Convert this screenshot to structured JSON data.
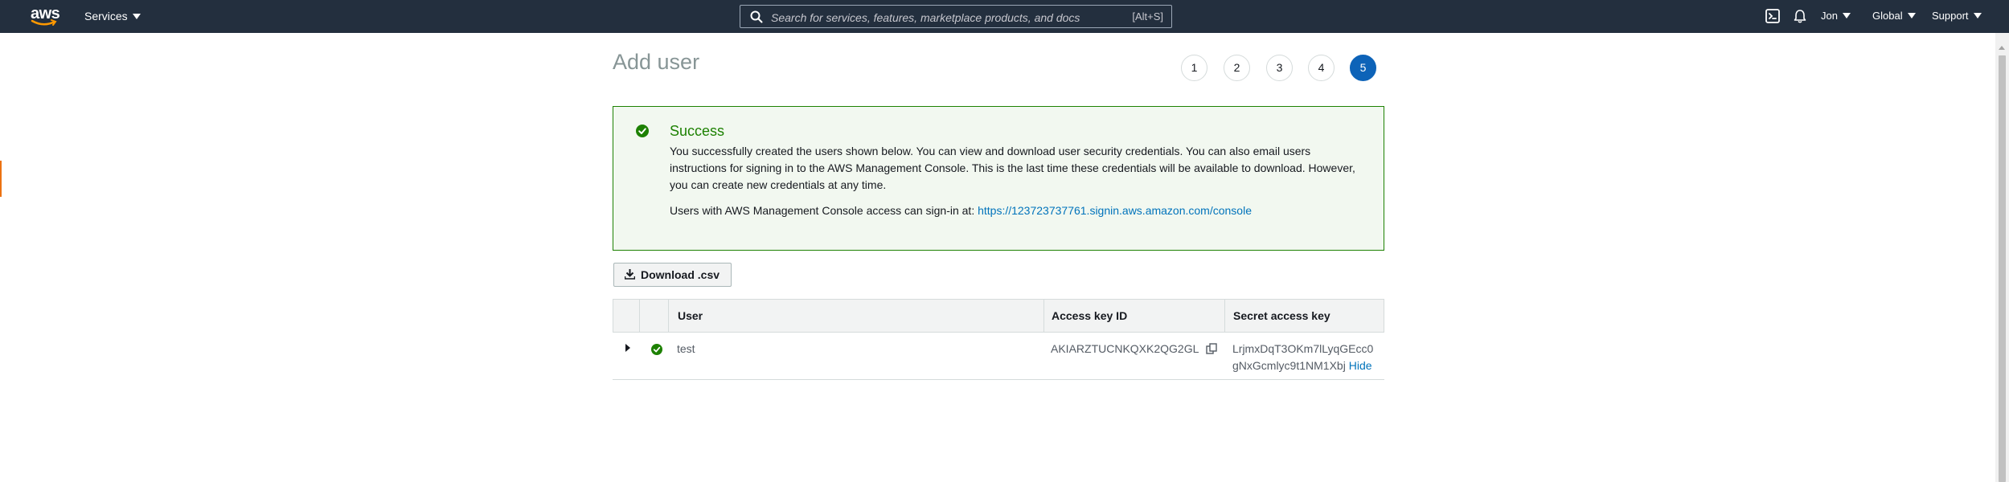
{
  "topnav": {
    "logo_text": "aws",
    "services_label": "Services",
    "search_placeholder": "Search for services, features, marketplace products, and docs",
    "search_shortcut": "[Alt+S]",
    "user_label": "Jon",
    "region_label": "Global",
    "support_label": "Support"
  },
  "page": {
    "title": "Add user",
    "steps": [
      "1",
      "2",
      "3",
      "4",
      "5"
    ],
    "active_step": "5"
  },
  "success": {
    "title": "Success",
    "message": "You successfully created the users shown below. You can view and download user security credentials. You can also email users instructions for signing in to the AWS Management Console. This is the last time these credentials will be available to download. However, you can create new credentials at any time.",
    "signin_prefix": "Users with AWS Management Console access can sign-in at: ",
    "signin_url": "https://123723737761.signin.aws.amazon.com/console"
  },
  "download_label": "Download .csv",
  "table": {
    "headers": {
      "user": "User",
      "access_key_id": "Access key ID",
      "secret_access_key": "Secret access key"
    },
    "rows": [
      {
        "user": "test",
        "access_key_id": "AKIARZTUCNKQXK2QG2GL",
        "secret_line1": "LrjmxDqT3OKm7lLyqGEcc0",
        "secret_line2": "gNxGcmlyc9t1NM1Xbj",
        "hide_label": "Hide"
      }
    ]
  },
  "colors": {
    "nav_bg": "#232f3e",
    "success_green": "#1d8102",
    "success_bg": "#f2f8f0",
    "link_blue": "#0073bb",
    "active_step": "#0d63b8"
  }
}
